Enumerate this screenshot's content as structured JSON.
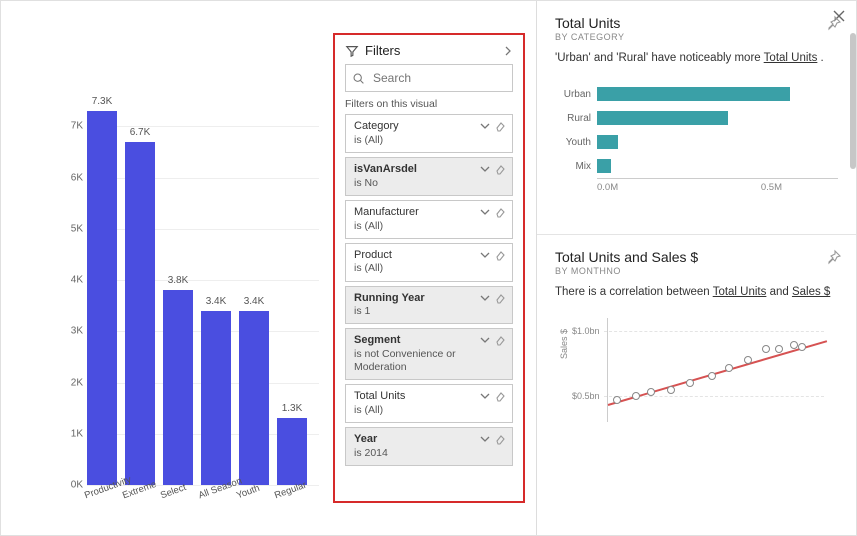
{
  "chart_data": [
    {
      "type": "bar",
      "categories": [
        "Productivity",
        "Extreme",
        "Select",
        "All Season",
        "Youth",
        "Regular"
      ],
      "values": [
        7300,
        6700,
        3800,
        3400,
        3400,
        1300
      ],
      "value_labels": [
        "7.3K",
        "6.7K",
        "3.8K",
        "3.4K",
        "3.4K",
        "1.3K"
      ],
      "yticks": [
        0,
        1000,
        2000,
        3000,
        4000,
        5000,
        6000,
        7000
      ],
      "ytick_labels": [
        "0K",
        "1K",
        "2K",
        "3K",
        "4K",
        "5K",
        "6K",
        "7K"
      ],
      "ylim": [
        0,
        8000
      ]
    },
    {
      "type": "bar",
      "orientation": "horizontal",
      "title": "Total Units",
      "subtitle": "BY CATEGORY",
      "caption_parts": [
        "'Urban' and 'Rural' have noticeably more ",
        "Total Units",
        " ."
      ],
      "categories": [
        "Urban",
        "Rural",
        "Youth",
        "Mix"
      ],
      "values": [
        560000,
        380000,
        60000,
        40000
      ],
      "xlim": [
        0,
        700000
      ],
      "xticks": [
        "0.0M",
        "0.5M"
      ]
    },
    {
      "type": "scatter",
      "title": "Total Units and Sales $",
      "subtitle": "BY MONTHNO",
      "caption_parts": [
        "There is a correlation between ",
        "Total Units",
        " and ",
        "Sales $"
      ],
      "ylabel": "Sales $",
      "ylim": [
        300000000,
        1100000000
      ],
      "yticks": [
        "$0.5bn",
        "$1.0bn"
      ],
      "points": [
        {
          "x": 0.04,
          "y": 470000000
        },
        {
          "x": 0.13,
          "y": 500000000
        },
        {
          "x": 0.2,
          "y": 530000000
        },
        {
          "x": 0.29,
          "y": 545000000
        },
        {
          "x": 0.38,
          "y": 600000000
        },
        {
          "x": 0.48,
          "y": 655000000
        },
        {
          "x": 0.56,
          "y": 720000000
        },
        {
          "x": 0.65,
          "y": 780000000
        },
        {
          "x": 0.73,
          "y": 860000000
        },
        {
          "x": 0.79,
          "y": 860000000
        },
        {
          "x": 0.86,
          "y": 890000000
        },
        {
          "x": 0.9,
          "y": 880000000
        }
      ],
      "trendline": {
        "x1": 0.0,
        "y1": 440000000,
        "x2": 0.95,
        "y2": 930000000
      }
    }
  ],
  "filters": {
    "title": "Filters",
    "search_placeholder": "Search",
    "section_label": "Filters on this visual",
    "items": [
      {
        "name": "Category",
        "cond": "is (All)",
        "active": false
      },
      {
        "name": "isVanArsdel",
        "cond": "is No",
        "active": true
      },
      {
        "name": "Manufacturer",
        "cond": "is (All)",
        "active": false
      },
      {
        "name": "Product",
        "cond": "is (All)",
        "active": false
      },
      {
        "name": "Running Year",
        "cond": "is 1",
        "active": true
      },
      {
        "name": "Segment",
        "cond": "is not Convenience or Moderation",
        "active": true
      },
      {
        "name": "Total Units",
        "cond": "is (All)",
        "active": false
      },
      {
        "name": "Year",
        "cond": "is 2014",
        "active": true
      }
    ]
  },
  "right": {
    "card1": {
      "title": "Total Units",
      "subtitle": "BY CATEGORY"
    },
    "card2": {
      "title": "Total Units and Sales $",
      "subtitle": "BY MONTHNO"
    }
  }
}
